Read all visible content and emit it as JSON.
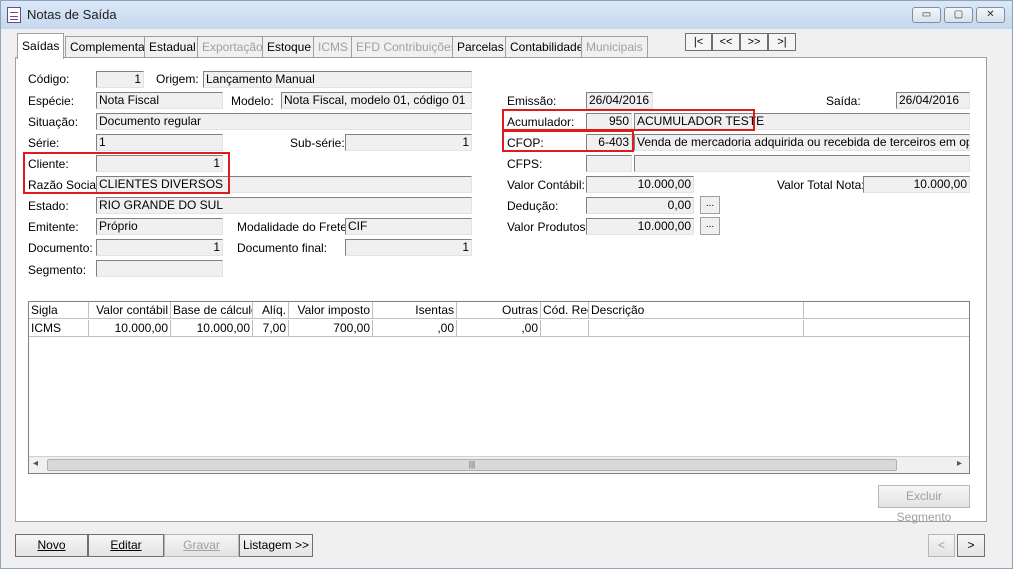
{
  "window": {
    "title": "Notas de Saída",
    "icon": "document-icon",
    "controls": {
      "minimize": "▭",
      "maximize": "▢",
      "close": "✕"
    }
  },
  "tabs": [
    {
      "label": "Saídas",
      "active": true,
      "enabled": true
    },
    {
      "label": "Complementar",
      "active": false,
      "enabled": true
    },
    {
      "label": "Estadual",
      "active": false,
      "enabled": true
    },
    {
      "label": "Exportação",
      "active": false,
      "enabled": false
    },
    {
      "label": "Estoque",
      "active": false,
      "enabled": true
    },
    {
      "label": "ICMS",
      "active": false,
      "enabled": false
    },
    {
      "label": "EFD Contribuições",
      "active": false,
      "enabled": false
    },
    {
      "label": "Parcelas",
      "active": false,
      "enabled": true
    },
    {
      "label": "Contabilidade",
      "active": false,
      "enabled": true
    },
    {
      "label": "Municipais",
      "active": false,
      "enabled": false
    }
  ],
  "record_nav": {
    "first": "|<",
    "prev": "<<",
    "next": ">>",
    "last": ">|"
  },
  "form": {
    "codigo": {
      "label": "Código:",
      "value": "1"
    },
    "origem": {
      "label": "Origem:",
      "value": "Lançamento Manual"
    },
    "especie": {
      "label": "Espécie:",
      "value": "Nota Fiscal"
    },
    "modelo": {
      "label": "Modelo:",
      "value": "Nota Fiscal, modelo 01, código 01"
    },
    "situacao": {
      "label": "Situação:",
      "value": "Documento regular"
    },
    "serie": {
      "label": "Série:",
      "value": "1"
    },
    "subserie": {
      "label": "Sub-série:",
      "value": "1"
    },
    "cliente": {
      "label": "Cliente:",
      "value": "1"
    },
    "razao_social": {
      "label": "Razão Social:",
      "value": "CLIENTES DIVERSOS"
    },
    "estado": {
      "label": "Estado:",
      "value": "RIO GRANDE DO SUL"
    },
    "emitente": {
      "label": "Emitente:",
      "value": "Próprio"
    },
    "modalidade_frete": {
      "label": "Modalidade do Frete:",
      "value": "CIF"
    },
    "documento": {
      "label": "Documento:",
      "value": "1"
    },
    "documento_final": {
      "label": "Documento final:",
      "value": "1"
    },
    "segmento": {
      "label": "Segmento:",
      "value": ""
    },
    "emissao": {
      "label": "Emissão:",
      "value": "26/04/2016"
    },
    "saida": {
      "label": "Saída:",
      "value": "26/04/2016"
    },
    "acumulador": {
      "label": "Acumulador:",
      "code": "950",
      "value": "ACUMULADOR TESTE"
    },
    "cfop": {
      "label": "CFOP:",
      "code": "6-403",
      "value": "Venda de mercadoria adquirida ou recebida de terceiros em operação"
    },
    "cfps": {
      "label": "CFPS:",
      "code": "",
      "value": ""
    },
    "valor_contabil": {
      "label": "Valor Contábil:",
      "value": "10.000,00"
    },
    "valor_total_nota": {
      "label": "Valor Total Nota:",
      "value": "10.000,00"
    },
    "deducao": {
      "label": "Dedução:",
      "value": "0,00"
    },
    "valor_produtos": {
      "label": "Valor Produtos:",
      "value": "10.000,00"
    },
    "ellipsis": "..."
  },
  "tax_table": {
    "columns": [
      "Sigla",
      "Valor contábil",
      "Base de cálculo",
      "Alíq.",
      "Valor imposto",
      "Isentas",
      "Outras",
      "Cód. Rec.",
      "Descrição"
    ],
    "rows": [
      [
        "ICMS",
        "10.000,00",
        "10.000,00",
        "7,00",
        "700,00",
        ",00",
        ",00",
        "",
        ""
      ]
    ],
    "scroll_left": "◂",
    "scroll_right": "▸",
    "scroll_grip": "|||"
  },
  "buttons": {
    "excluir_segmento": "Excluir Segmento",
    "novo": "Novo",
    "editar": "Editar",
    "gravar": "Gravar",
    "listagem": "Listagem >>",
    "prev": "<",
    "next": ">"
  },
  "colors": {
    "highlight": "#e01b1b",
    "panel": "#ffffff",
    "window": "#f0f0f0"
  }
}
